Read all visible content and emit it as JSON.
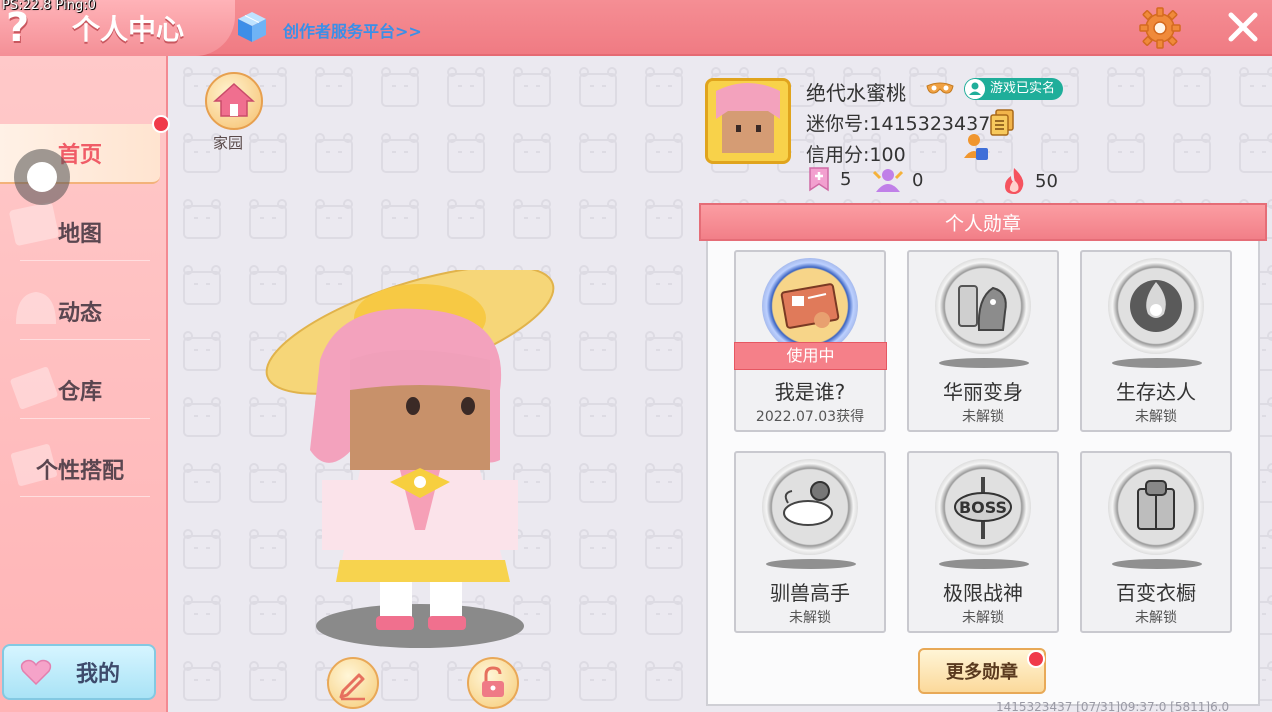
{
  "debug": {
    "text": "PS:22.8  Ping:0"
  },
  "header": {
    "title": "个人中心",
    "help_label": "?",
    "creator_link": "创作者服务平台>>"
  },
  "sidebar": {
    "items": [
      {
        "label": "首页",
        "active": true
      },
      {
        "label": "地图"
      },
      {
        "label": "动态"
      },
      {
        "label": "仓库"
      },
      {
        "label": "个性搭配"
      }
    ],
    "my_button": "我的"
  },
  "home": {
    "label": "家园"
  },
  "profile": {
    "nickname": "绝代水蜜桃",
    "realname_badge": "游戏已实名",
    "uid": "迷你号:1415323437",
    "credit": "信用分:100",
    "stats": [
      {
        "icon": "bookmark-icon",
        "value": "5"
      },
      {
        "icon": "fan-icon",
        "value": "0"
      },
      {
        "icon": "flame-icon",
        "value": "50"
      }
    ]
  },
  "medals": {
    "title": "个人勋章",
    "in_use_label": "使用中",
    "items": [
      {
        "name": "我是谁?",
        "sub": "2022.07.03获得",
        "active": true,
        "icon": "id-card-icon"
      },
      {
        "name": "华丽变身",
        "sub": "未解锁",
        "active": false,
        "icon": "dino-mirror-icon"
      },
      {
        "name": "生存达人",
        "sub": "未解锁",
        "active": false,
        "icon": "campfire-icon"
      },
      {
        "name": "驯兽高手",
        "sub": "未解锁",
        "active": false,
        "icon": "tame-beast-icon"
      },
      {
        "name": "极限战神",
        "sub": "未解锁",
        "active": false,
        "icon": "boss-sign-icon"
      },
      {
        "name": "百变衣橱",
        "sub": "未解锁",
        "active": false,
        "icon": "wardrobe-icon"
      }
    ],
    "more_button": "更多勋章"
  },
  "footer": {
    "text": "1415323437    [07/31]09:37:0  [5811]6.0"
  },
  "colors": {
    "header": "#f07b83",
    "accent": "#f05c67",
    "panel_header": "#f27f88",
    "badge": "#1fae9a"
  }
}
